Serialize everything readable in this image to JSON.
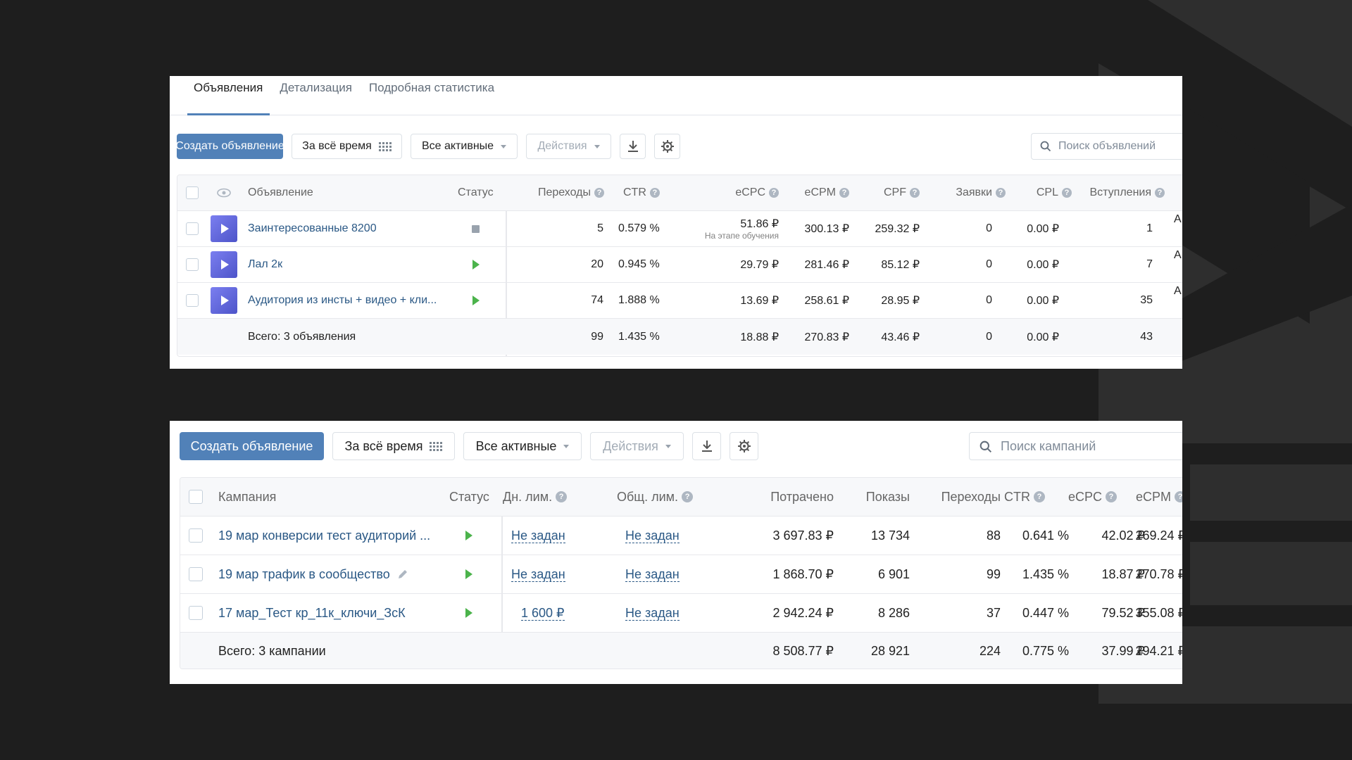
{
  "ads_panel": {
    "tabs": [
      {
        "label": "Объявления"
      },
      {
        "label": "Детализация"
      },
      {
        "label": "Подробная статистика"
      }
    ],
    "toolbar": {
      "create_label": "Создать объявление",
      "period_label": "За всё время",
      "filter_label": "Все активные",
      "actions_label": "Действия",
      "search_placeholder": "Поиск объявлений"
    },
    "columns": {
      "ad": "Объявление",
      "status": "Статус",
      "clicks": "Переходы",
      "ctr": "CTR",
      "ecpc": "eCPC",
      "ecpm": "eCPM",
      "cpf": "CPF",
      "leads": "Заявки",
      "cpl": "CPL",
      "joins": "Вступления"
    },
    "rows": [
      {
        "name": "Заинтересованные 8200",
        "status": "stopped",
        "clicks": "5",
        "ctr": "0.579 %",
        "ecpc": "51.86 ₽",
        "ecpc_note": "На этапе обучения",
        "ecpm": "300.13 ₽",
        "cpf": "259.32 ₽",
        "leads": "0",
        "cpl": "0.00 ₽",
        "joins": "1",
        "cut": "А"
      },
      {
        "name": "Лал 2к",
        "status": "active",
        "clicks": "20",
        "ctr": "0.945 %",
        "ecpc": "29.79 ₽",
        "ecpc_note": "",
        "ecpm": "281.46 ₽",
        "cpf": "85.12 ₽",
        "leads": "0",
        "cpl": "0.00 ₽",
        "joins": "7",
        "cut": "А"
      },
      {
        "name": "Аудитория из инсты + видео + кли...",
        "status": "active",
        "clicks": "74",
        "ctr": "1.888 %",
        "ecpc": "13.69 ₽",
        "ecpc_note": "",
        "ecpm": "258.61 ₽",
        "cpf": "28.95 ₽",
        "leads": "0",
        "cpl": "0.00 ₽",
        "joins": "35",
        "cut": "А"
      }
    ],
    "total": {
      "label": "Всего: 3 объявления",
      "clicks": "99",
      "ctr": "1.435 %",
      "ecpc": "18.88 ₽",
      "ecpm": "270.83 ₽",
      "cpf": "43.46 ₽",
      "leads": "0",
      "cpl": "0.00 ₽",
      "joins": "43"
    }
  },
  "campaigns_panel": {
    "toolbar": {
      "create_label": "Создать объявление",
      "period_label": "За всё время",
      "filter_label": "Все активные",
      "actions_label": "Действия",
      "search_placeholder": "Поиск кампаний"
    },
    "columns": {
      "campaign": "Кампания",
      "status": "Статус",
      "day_limit": "Дн. лим.",
      "total_limit": "Общ. лим.",
      "spent": "Потрачено",
      "impressions": "Показы",
      "clicks": "Переходы",
      "ctr": "CTR",
      "ecpc": "eCPC",
      "ecpm": "eCPM"
    },
    "rows": [
      {
        "name": "19 мар конверсии тест аудиторий ...",
        "status": "active",
        "day_limit": "Не задан",
        "total_limit": "Не задан",
        "spent": "3 697.83 ₽",
        "impressions": "13 734",
        "clicks": "88",
        "ctr": "0.641 %",
        "ecpc": "42.02 ₽",
        "ecpm": "269.24 ₽",
        "editable": false
      },
      {
        "name": "19 мар трафик в сообщество",
        "status": "active",
        "day_limit": "Не задан",
        "total_limit": "Не задан",
        "spent": "1 868.70 ₽",
        "impressions": "6 901",
        "clicks": "99",
        "ctr": "1.435 %",
        "ecpc": "18.87 ₽",
        "ecpm": "270.78 ₽",
        "editable": true
      },
      {
        "name": "17 мар_Тест кр_11к_ключи_ЗсК",
        "status": "active",
        "day_limit": "1 600 ₽",
        "total_limit": "Не задан",
        "spent": "2 942.24 ₽",
        "impressions": "8 286",
        "clicks": "37",
        "ctr": "0.447 %",
        "ecpc": "79.52 ₽",
        "ecpm": "355.08 ₽",
        "editable": false
      }
    ],
    "total": {
      "label": "Всего: 3 кампании",
      "spent": "8 508.77 ₽",
      "impressions": "28 921",
      "clicks": "224",
      "ctr": "0.775 %",
      "ecpc": "37.99 ₽",
      "ecpm": "294.21 ₽"
    }
  },
  "colors": {
    "accent": "#5181b8",
    "link": "#2a5885",
    "active_status": "#4bb34b",
    "background": "#1e1e1e"
  }
}
